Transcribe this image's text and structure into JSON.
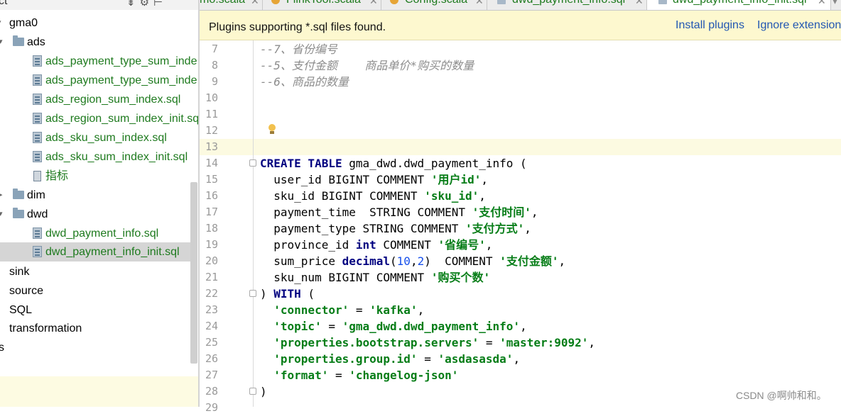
{
  "project_panel": {
    "header_label": "ct",
    "items": [
      {
        "label": "gma0",
        "type": "folder",
        "depth": 0,
        "expanded": true
      },
      {
        "label": "ads",
        "type": "folder",
        "depth": 1,
        "expanded": true
      },
      {
        "label": "ads_payment_type_sum_inde",
        "type": "sql",
        "depth": 2
      },
      {
        "label": "ads_payment_type_sum_inde",
        "type": "sql",
        "depth": 2
      },
      {
        "label": "ads_region_sum_index.sql",
        "type": "sql",
        "depth": 2
      },
      {
        "label": "ads_region_sum_index_init.sq",
        "type": "sql",
        "depth": 2
      },
      {
        "label": "ads_sku_sum_index.sql",
        "type": "sql",
        "depth": 2
      },
      {
        "label": "ads_sku_sum_index_init.sql",
        "type": "sql",
        "depth": 2
      },
      {
        "label": "指标",
        "type": "doc",
        "depth": 2
      },
      {
        "label": "dim",
        "type": "folder",
        "depth": 1,
        "expanded": false
      },
      {
        "label": "dwd",
        "type": "folder",
        "depth": 1,
        "expanded": true
      },
      {
        "label": "dwd_payment_info.sql",
        "type": "sql",
        "depth": 2
      },
      {
        "label": "dwd_payment_info_init.sql",
        "type": "sql",
        "depth": 2,
        "selected": true
      },
      {
        "label": "sink",
        "type": "folder",
        "depth": 0
      },
      {
        "label": "source",
        "type": "folder",
        "depth": 0
      },
      {
        "label": "SQL",
        "type": "folder",
        "depth": 0
      },
      {
        "label": "transformation",
        "type": "folder",
        "depth": 0
      },
      {
        "label": "s",
        "type": "folder",
        "depth": 0
      }
    ]
  },
  "tabs": [
    {
      "label": "mo.scala",
      "icon": "scala-file-icon",
      "active": false
    },
    {
      "label": "FlinkTool.scala",
      "icon": "scala-file-icon",
      "active": false
    },
    {
      "label": "Config.scala",
      "icon": "scala-object-icon",
      "active": false
    },
    {
      "label": "dwd_payment_info.sql",
      "icon": "sql-file-icon",
      "active": false
    },
    {
      "label": "dwd_payment_info_init.sql",
      "icon": "sql-file-icon",
      "active": true
    }
  ],
  "banner": {
    "text": "Plugins supporting *.sql files found.",
    "install_label": "Install plugins",
    "ignore_label": "Ignore extension"
  },
  "editor": {
    "line_numbers": [
      "7",
      "8",
      "9",
      "10",
      "11",
      "12",
      "13",
      "14",
      "15",
      "16",
      "17",
      "18",
      "19",
      "20",
      "21",
      "22",
      "23",
      "24",
      "25",
      "26",
      "27",
      "28",
      "29"
    ],
    "current_line": "13",
    "lines": {
      "l7": "--7、省份编号",
      "l8": "--5、支付金额    商品单价*购买的数量",
      "l9": "--6、商品的数量",
      "l14_kw": "CREATE TABLE",
      "l14_rest": " gma_dwd.dwd_payment_info (",
      "l15_a": "  user_id BIGINT COMMENT ",
      "l15_s": "'用户id'",
      "l16_a": "  sku_id BIGINT COMMENT ",
      "l16_s": "'sku_id'",
      "l17_a": "  payment_time  STRING COMMENT ",
      "l17_s": "'支付时间'",
      "l18_a": "  payment_type STRING COMMENT ",
      "l18_s": "'支付方式'",
      "l19_a": "  province_id ",
      "l19_kw": "int",
      "l19_b": " COMMENT ",
      "l19_s": "'省编号'",
      "l20_a": "  sum_price ",
      "l20_kw": "decimal",
      "l20_p1": "(",
      "l20_n1": "10",
      "l20_c": ",",
      "l20_n2": "2",
      "l20_p2": ")  COMMENT ",
      "l20_s": "'支付金额'",
      "l21_a": "  sku_num BIGINT COMMENT ",
      "l21_s": "'购买个数'",
      "l22_a": ") ",
      "l22_kw": "WITH",
      "l22_b": " (",
      "l23_s1": "'connector'",
      "l23_eq": " = ",
      "l23_s2": "'kafka'",
      "l24_s1": "'topic'",
      "l24_eq": " = ",
      "l24_s2": "'gma_dwd.dwd_payment_info'",
      "l25_s1": "'properties.bootstrap.servers'",
      "l25_eq": " = ",
      "l25_s2": "'master:9092'",
      "l26_s1": "'properties.group.id'",
      "l26_eq": " = ",
      "l26_s2": "'asdasasda'",
      "l27_s1": "'format'",
      "l27_eq": " = ",
      "l27_s2": "'changelog-json'",
      "l28": ")"
    }
  },
  "watermark": "CSDN @啊帅和和。"
}
